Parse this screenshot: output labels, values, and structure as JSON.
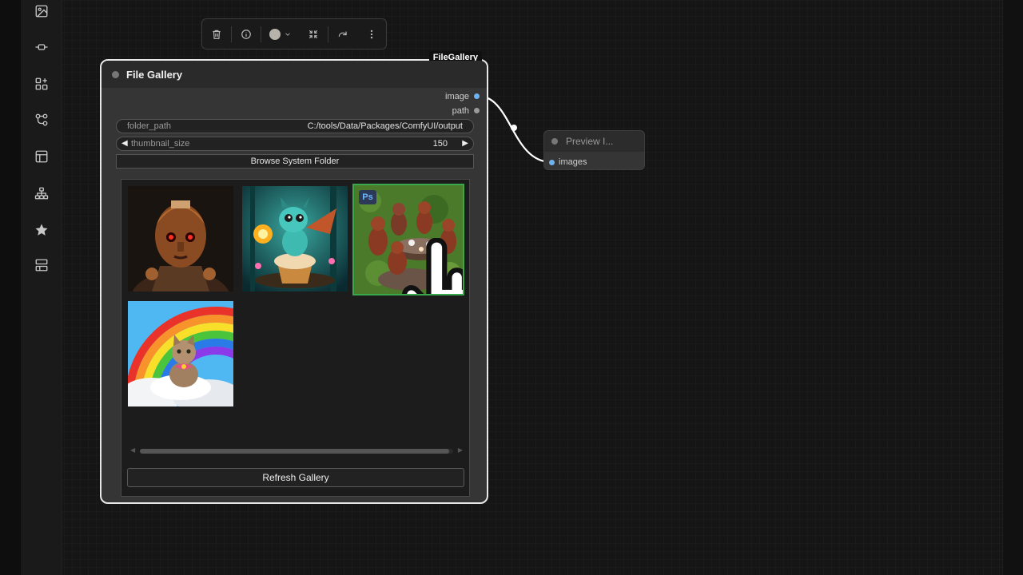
{
  "toolbar": {
    "icons": [
      "trash-icon",
      "info-icon",
      "color-picker",
      "collapse-icon",
      "bypass-icon",
      "more-vertical-icon"
    ],
    "node_color": "#b7b2aa"
  },
  "sidebar": {
    "icons": [
      "image-icon",
      "link-icon",
      "extensions-icon",
      "workflows-icon",
      "templates-icon",
      "nodes-tree-icon",
      "star-icon",
      "layout-icon"
    ]
  },
  "node": {
    "badge": "FileGallery",
    "title": "File Gallery",
    "outputs": [
      {
        "label": "image",
        "color": "#6fb2f2"
      },
      {
        "label": "path",
        "color": "#9a9a9a"
      }
    ],
    "widgets": {
      "folder_path": {
        "name": "folder_path",
        "value": "C:/tools/Data/Packages/ComfyUI/output"
      },
      "thumbnail_size": {
        "name": "thumbnail_size",
        "value": "150"
      }
    },
    "browse_button": "Browse System Folder",
    "gallery": {
      "thumbnails": [
        "robot-portrait-thumbnail",
        "baby-dragon-cupcake-thumbnail",
        "squirrel-tea-party-thumbnail",
        "rainbow-kitten-thumbnail"
      ],
      "selected_index": 2,
      "selected_badge": "Ps"
    },
    "refresh_button": "Refresh Gallery"
  },
  "preview_node": {
    "title": "Preview I...",
    "input_label": "images"
  },
  "colors": {
    "canvas": "#151515",
    "node_body": "#353535",
    "node_border_selected": "#e8e8e8",
    "selected_thumbnail_border": "#39a84a",
    "image_slot": "#6fb2f2"
  }
}
